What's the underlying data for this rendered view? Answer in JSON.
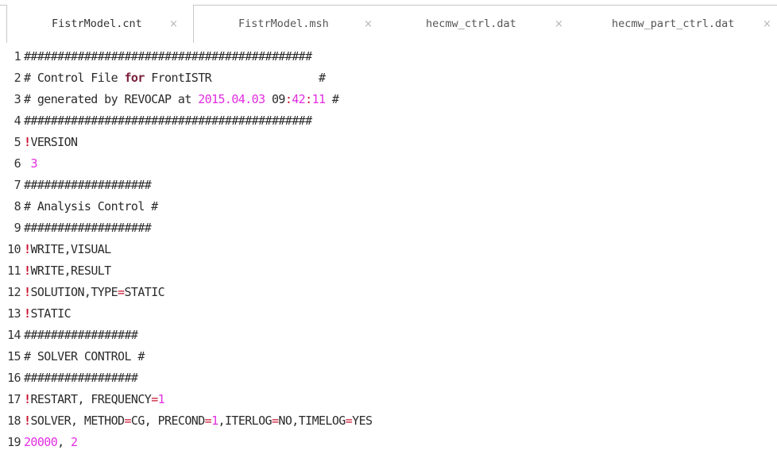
{
  "tabs": [
    {
      "label": "FistrModel.cnt",
      "active": true
    },
    {
      "label": "FistrModel.msh",
      "active": false
    },
    {
      "label": "hecmw_ctrl.dat",
      "active": false
    },
    {
      "label": "hecmw_part_ctrl.dat",
      "active": false
    }
  ],
  "tab_close_glyph": "×",
  "colors": {
    "keyword": "#7a1e3a",
    "number": "#e22de0",
    "bang": "#c8102e",
    "text": "#2b2b2b"
  },
  "lines": [
    {
      "num": "1",
      "tokens": [
        {
          "t": "plain",
          "v": "###########################################"
        }
      ]
    },
    {
      "num": "2",
      "tokens": [
        {
          "t": "plain",
          "v": "# Control File "
        },
        {
          "t": "kw",
          "v": "for"
        },
        {
          "t": "plain",
          "v": " FrontISTR                #"
        }
      ]
    },
    {
      "num": "3",
      "tokens": [
        {
          "t": "plain",
          "v": "# generated by REVOCAP at "
        },
        {
          "t": "num",
          "v": "2015.04.03"
        },
        {
          "t": "plain",
          "v": " 09"
        },
        {
          "t": "op",
          "v": ":"
        },
        {
          "t": "num",
          "v": "42"
        },
        {
          "t": "op",
          "v": ":"
        },
        {
          "t": "num",
          "v": "11"
        },
        {
          "t": "plain",
          "v": " #"
        }
      ]
    },
    {
      "num": "4",
      "tokens": [
        {
          "t": "plain",
          "v": "###########################################"
        }
      ]
    },
    {
      "num": "5",
      "tokens": [
        {
          "t": "bang",
          "v": "!"
        },
        {
          "t": "plain",
          "v": "VERSION"
        }
      ]
    },
    {
      "num": "6",
      "tokens": [
        {
          "t": "plain",
          "v": " "
        },
        {
          "t": "num",
          "v": "3"
        }
      ]
    },
    {
      "num": "7",
      "tokens": [
        {
          "t": "plain",
          "v": "###################"
        }
      ]
    },
    {
      "num": "8",
      "tokens": [
        {
          "t": "plain",
          "v": "# Analysis Control #"
        }
      ]
    },
    {
      "num": "9",
      "tokens": [
        {
          "t": "plain",
          "v": "###################"
        }
      ]
    },
    {
      "num": "10",
      "tokens": [
        {
          "t": "bang",
          "v": "!"
        },
        {
          "t": "plain",
          "v": "WRITE,VISUAL"
        }
      ]
    },
    {
      "num": "11",
      "tokens": [
        {
          "t": "bang",
          "v": "!"
        },
        {
          "t": "plain",
          "v": "WRITE,RESULT"
        }
      ]
    },
    {
      "num": "12",
      "tokens": [
        {
          "t": "bang",
          "v": "!"
        },
        {
          "t": "plain",
          "v": "SOLUTION,TYPE"
        },
        {
          "t": "op",
          "v": "="
        },
        {
          "t": "plain",
          "v": "STATIC"
        }
      ]
    },
    {
      "num": "13",
      "tokens": [
        {
          "t": "bang",
          "v": "!"
        },
        {
          "t": "plain",
          "v": "STATIC"
        }
      ]
    },
    {
      "num": "14",
      "tokens": [
        {
          "t": "plain",
          "v": "#################"
        }
      ]
    },
    {
      "num": "15",
      "tokens": [
        {
          "t": "plain",
          "v": "# SOLVER CONTROL #"
        }
      ]
    },
    {
      "num": "16",
      "tokens": [
        {
          "t": "plain",
          "v": "#################"
        }
      ]
    },
    {
      "num": "17",
      "tokens": [
        {
          "t": "bang",
          "v": "!"
        },
        {
          "t": "plain",
          "v": "RESTART, FREQUENCY"
        },
        {
          "t": "op",
          "v": "="
        },
        {
          "t": "num",
          "v": "1"
        }
      ]
    },
    {
      "num": "18",
      "tokens": [
        {
          "t": "bang",
          "v": "!"
        },
        {
          "t": "plain",
          "v": "SOLVER, METHOD"
        },
        {
          "t": "op",
          "v": "="
        },
        {
          "t": "plain",
          "v": "CG, PRECOND"
        },
        {
          "t": "op",
          "v": "="
        },
        {
          "t": "num",
          "v": "1"
        },
        {
          "t": "plain",
          "v": ",ITERLOG"
        },
        {
          "t": "op",
          "v": "="
        },
        {
          "t": "plain",
          "v": "NO,TIMELOG"
        },
        {
          "t": "op",
          "v": "="
        },
        {
          "t": "plain",
          "v": "YES"
        }
      ]
    },
    {
      "num": "19",
      "tokens": [
        {
          "t": "num",
          "v": "20000"
        },
        {
          "t": "plain",
          "v": ", "
        },
        {
          "t": "num",
          "v": "2"
        }
      ]
    }
  ]
}
